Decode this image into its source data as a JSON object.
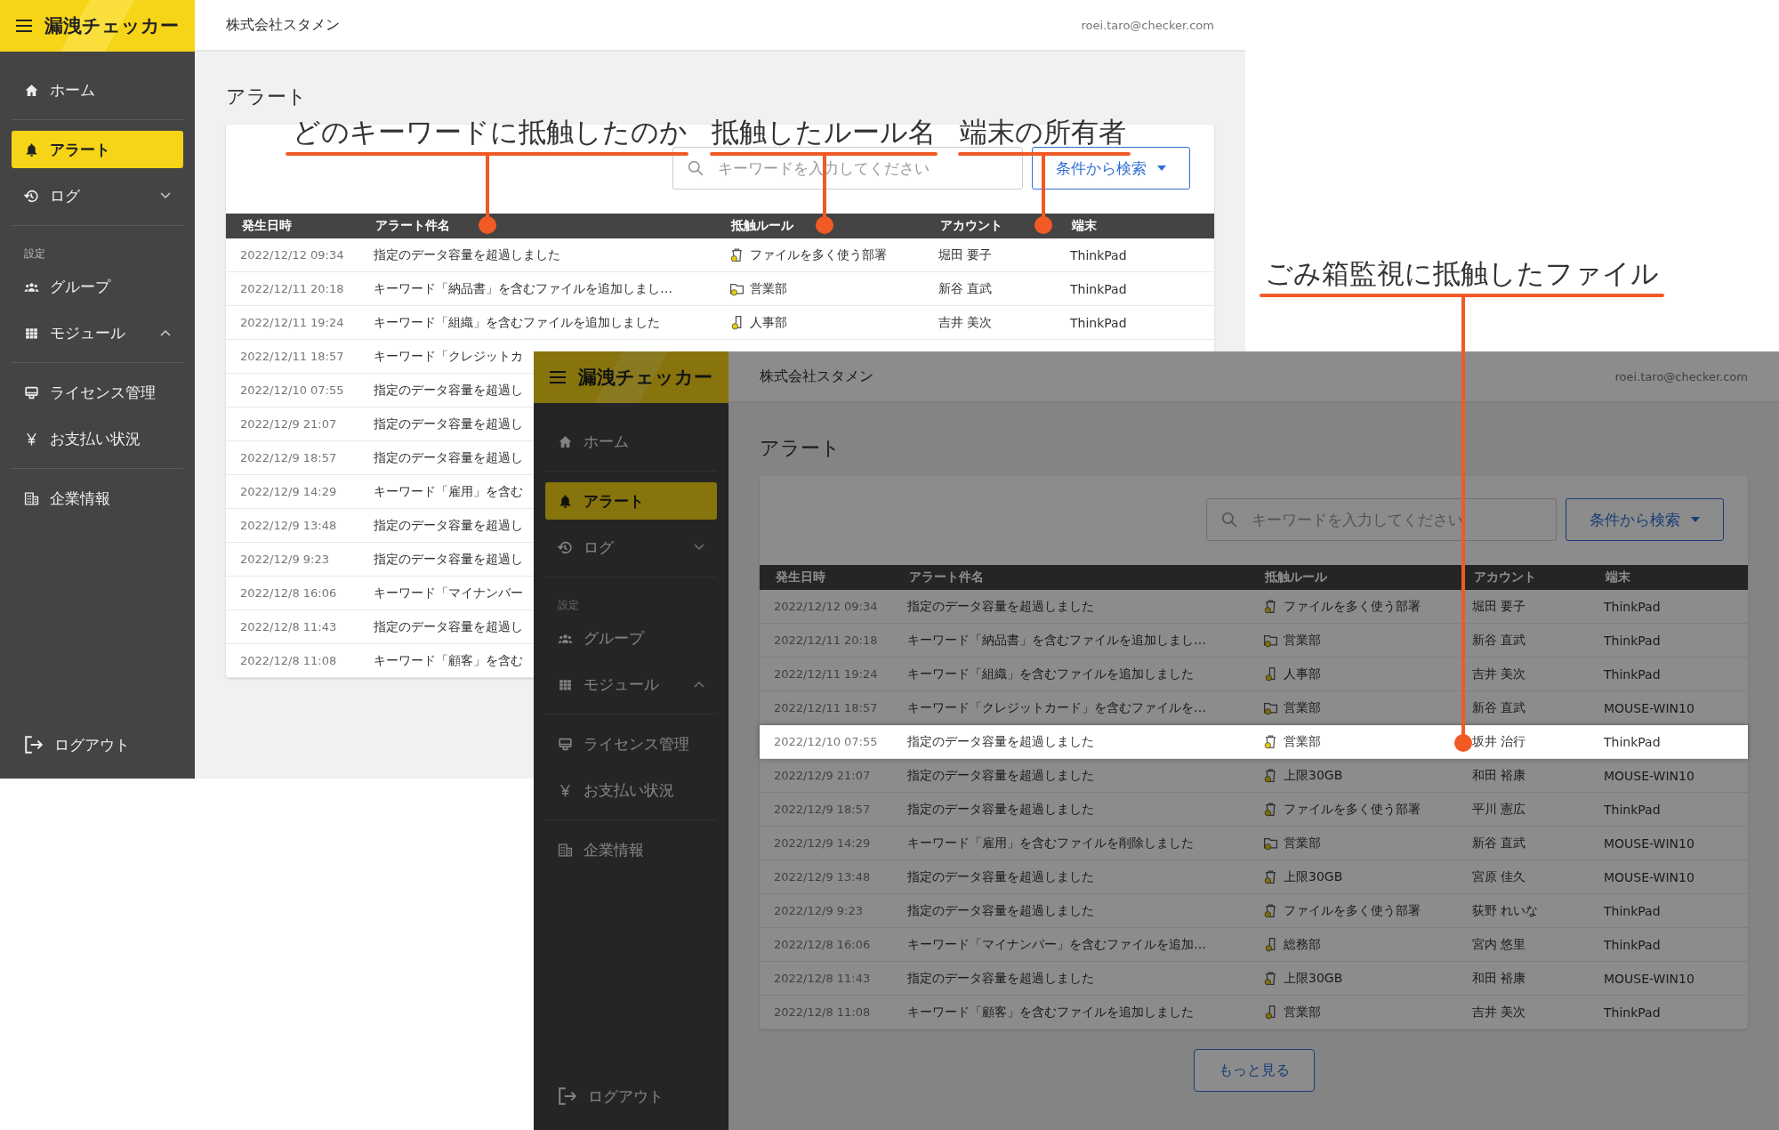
{
  "annotations": [
    {
      "text": "どのキーワードに抵触したのか"
    },
    {
      "text": "抵触したルール名"
    },
    {
      "text": "端末の所有者"
    },
    {
      "text": "ごみ箱監視に抵触したファイル"
    }
  ],
  "screens": [
    {
      "app_name": "漏洩チェッカー",
      "company": "株式会社スタメン",
      "user_email": "roei.taro@checker.com",
      "sidebar": {
        "groups": [
          {
            "items": [
              {
                "label": "ホーム",
                "selected": false
              }
            ]
          },
          {
            "items": [
              {
                "label": "アラート",
                "selected": true
              },
              {
                "label": "ログ",
                "selected": false,
                "expanded": false
              }
            ]
          },
          {
            "heading": "設定",
            "items": [
              {
                "label": "グループ",
                "selected": false
              },
              {
                "label": "モジュール",
                "selected": false,
                "expanded": true
              }
            ]
          },
          {
            "items": [
              {
                "label": "ライセンス管理",
                "selected": false
              },
              {
                "label": "お支払い状況",
                "selected": false
              }
            ]
          },
          {
            "items": [
              {
                "label": "企業情報",
                "selected": false
              }
            ]
          }
        ],
        "logout": "ログアウト"
      },
      "page_title": "アラート",
      "search": {
        "placeholder": "キーワードを入力してください"
      },
      "filter_button": "条件から検索",
      "table": {
        "columns": [
          "発生日時",
          "アラート件名",
          "抵触ルール",
          "アカウント",
          "端末"
        ],
        "rows": [
          {
            "date": "2022/12/12 09:34",
            "title": "指定のデータ容量を超過しました",
            "rule": "ファイルを多く使う部署",
            "kind": "trash",
            "account": "堀田 要子",
            "device": "ThinkPad"
          },
          {
            "date": "2022/12/11 20:18",
            "title": "キーワード「納品書」を含むファイルを追加しまし…",
            "rule": "営業部",
            "kind": "folder",
            "account": "新谷 直武",
            "device": "ThinkPad"
          },
          {
            "date": "2022/12/11 19:24",
            "title": "キーワード「組織」を含むファイルを追加しました",
            "rule": "人事部",
            "kind": "file",
            "account": "吉井 美次",
            "device": "ThinkPad"
          },
          {
            "date": "2022/12/11 18:57",
            "title": "キーワード「クレジットカ"
          },
          {
            "date": "2022/12/10 07:55",
            "title": "指定のデータ容量を超過し"
          },
          {
            "date": "2022/12/9 21:07",
            "title": "指定のデータ容量を超過し"
          },
          {
            "date": "2022/12/9 18:57",
            "title": "指定のデータ容量を超過し"
          },
          {
            "date": "2022/12/9 14:29",
            "title": "キーワード「雇用」を含む"
          },
          {
            "date": "2022/12/9 13:48",
            "title": "指定のデータ容量を超過し"
          },
          {
            "date": "2022/12/9 9:23",
            "title": "指定のデータ容量を超過し"
          },
          {
            "date": "2022/12/8 16:06",
            "title": "キーワード「マイナンバー"
          },
          {
            "date": "2022/12/8 11:43",
            "title": "指定のデータ容量を超過し"
          },
          {
            "date": "2022/12/8 11:08",
            "title": "キーワード「顧客」を含む"
          }
        ]
      }
    },
    {
      "dimmed": true,
      "app_name": "漏洩チェッカー",
      "company": "株式会社スタメン",
      "user_email": "roei.taro@checker.com",
      "sidebar": {
        "groups": [
          {
            "items": [
              {
                "label": "ホーム",
                "selected": false
              }
            ]
          },
          {
            "items": [
              {
                "label": "アラート",
                "selected": true
              },
              {
                "label": "ログ",
                "selected": false,
                "expanded": false
              }
            ]
          },
          {
            "heading": "設定",
            "items": [
              {
                "label": "グループ",
                "selected": false
              },
              {
                "label": "モジュール",
                "selected": false,
                "expanded": true
              }
            ]
          },
          {
            "items": [
              {
                "label": "ライセンス管理",
                "selected": false
              },
              {
                "label": "お支払い状況",
                "selected": false
              }
            ]
          },
          {
            "items": [
              {
                "label": "企業情報",
                "selected": false
              }
            ]
          }
        ],
        "logout": "ログアウト"
      },
      "page_title": "アラート",
      "search": {
        "placeholder": "キーワードを入力してください"
      },
      "filter_button": "条件から検索",
      "table": {
        "columns": [
          "発生日時",
          "アラート件名",
          "抵触ルール",
          "アカウント",
          "端末"
        ],
        "rows": [
          {
            "date": "2022/12/12 09:34",
            "title": "指定のデータ容量を超過しました",
            "rule": "ファイルを多く使う部署",
            "kind": "trash",
            "account": "堀田 要子",
            "device": "ThinkPad",
            "highlighted": false
          },
          {
            "date": "2022/12/11 20:18",
            "title": "キーワード「納品書」を含むファイルを追加しまし…",
            "rule": "営業部",
            "kind": "folder",
            "account": "新谷 直武",
            "device": "ThinkPad",
            "highlighted": false
          },
          {
            "date": "2022/12/11 19:24",
            "title": "キーワード「組織」を含むファイルを追加しました",
            "rule": "人事部",
            "kind": "file",
            "account": "吉井 美次",
            "device": "ThinkPad",
            "highlighted": false
          },
          {
            "date": "2022/12/11 18:57",
            "title": "キーワード「クレジットカード」を含むファイルを…",
            "rule": "営業部",
            "kind": "folder",
            "account": "新谷 直武",
            "device": "MOUSE-WIN10",
            "highlighted": false
          },
          {
            "date": "2022/12/10 07:55",
            "title": "指定のデータ容量を超過しました",
            "rule": "営業部",
            "kind": "trash",
            "account": "坂井 治行",
            "device": "ThinkPad",
            "highlighted": true
          },
          {
            "date": "2022/12/9 21:07",
            "title": "指定のデータ容量を超過しました",
            "rule": "上限30GB",
            "kind": "trash",
            "account": "和田 裕康",
            "device": "MOUSE-WIN10",
            "highlighted": false
          },
          {
            "date": "2022/12/9 18:57",
            "title": "指定のデータ容量を超過しました",
            "rule": "ファイルを多く使う部署",
            "kind": "trash",
            "account": "平川 憲広",
            "device": "ThinkPad",
            "highlighted": false
          },
          {
            "date": "2022/12/9 14:29",
            "title": "キーワード「雇用」を含むファイルを削除しました",
            "rule": "営業部",
            "kind": "folder",
            "account": "新谷 直武",
            "device": "MOUSE-WIN10",
            "highlighted": false
          },
          {
            "date": "2022/12/9 13:48",
            "title": "指定のデータ容量を超過しました",
            "rule": "上限30GB",
            "kind": "trash",
            "account": "宮原 佳久",
            "device": "MOUSE-WIN10",
            "highlighted": false
          },
          {
            "date": "2022/12/9 9:23",
            "title": "指定のデータ容量を超過しました",
            "rule": "ファイルを多く使う部署",
            "kind": "trash",
            "account": "荻野 れいな",
            "device": "ThinkPad",
            "highlighted": false
          },
          {
            "date": "2022/12/8 16:06",
            "title": "キーワード「マイナンバー」を含むファイルを追加…",
            "rule": "総務部",
            "kind": "file",
            "account": "宮内 悠里",
            "device": "ThinkPad",
            "highlighted": false
          },
          {
            "date": "2022/12/8 11:43",
            "title": "指定のデータ容量を超過しました",
            "rule": "上限30GB",
            "kind": "trash",
            "account": "和田 裕康",
            "device": "MOUSE-WIN10",
            "highlighted": false
          },
          {
            "date": "2022/12/8 11:08",
            "title": "キーワード「顧客」を含むファイルを追加しました",
            "rule": "営業部",
            "kind": "file",
            "account": "吉井 美次",
            "device": "ThinkPad",
            "highlighted": false
          }
        ]
      },
      "more_button": "もっと見る"
    }
  ]
}
